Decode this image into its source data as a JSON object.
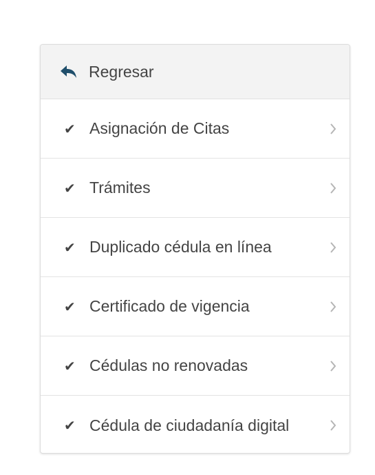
{
  "menu": {
    "back": {
      "label": "Regresar",
      "icon": "reply-arrow-icon"
    },
    "items": [
      {
        "label": "Asignación de Citas",
        "check": "✔",
        "icon": "checkmark-icon"
      },
      {
        "label": "Trámites",
        "check": "✔",
        "icon": "checkmark-icon"
      },
      {
        "label": "Duplicado cédula en línea",
        "check": "✔",
        "icon": "checkmark-icon"
      },
      {
        "label": "Certificado de vigencia",
        "check": "✔",
        "icon": "checkmark-icon"
      },
      {
        "label": "Cédulas no renovadas",
        "check": "✔",
        "icon": "checkmark-icon"
      },
      {
        "label": "Cédula de ciudadanía digital",
        "check": "✔",
        "icon": "checkmark-icon"
      }
    ]
  },
  "colors": {
    "back_icon": "#1f4e6b",
    "text": "#444444",
    "chevron": "#b5b5b5",
    "header_bg": "#f3f3f3",
    "divider": "#e3e3e3"
  }
}
